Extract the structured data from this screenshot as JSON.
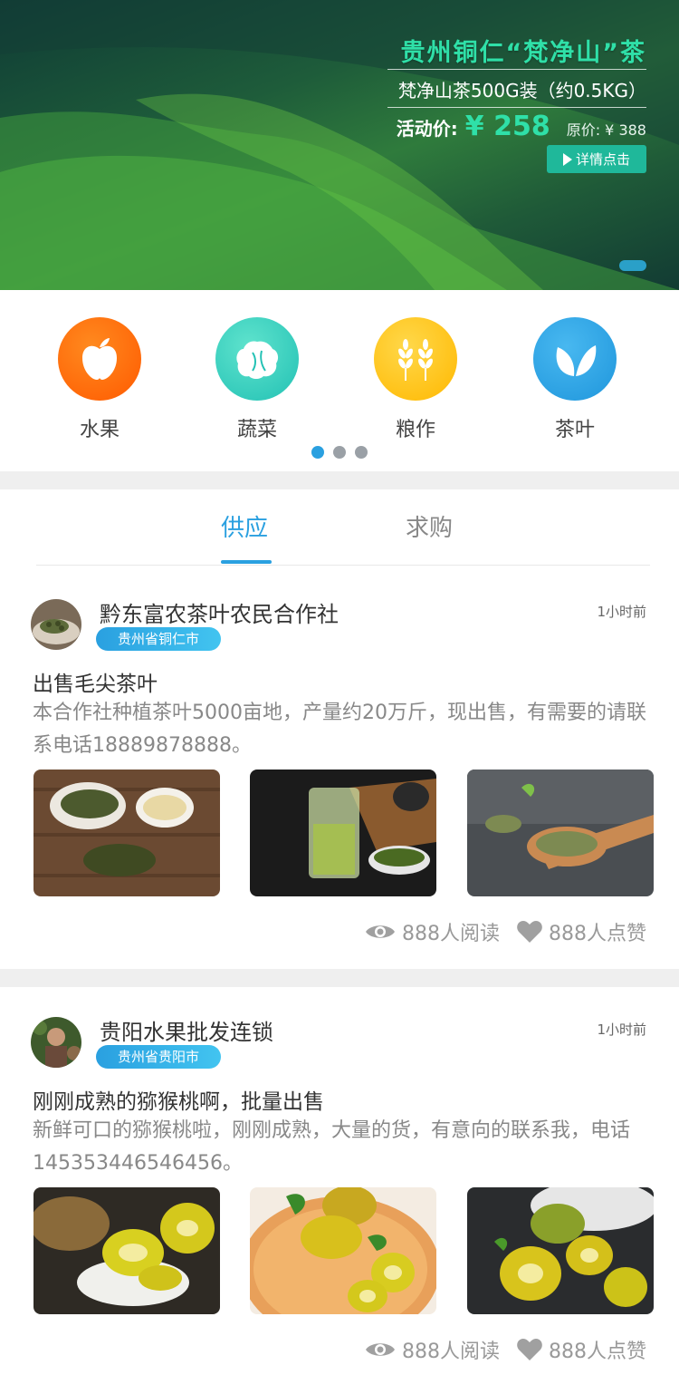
{
  "banner": {
    "title": "贵州铜仁“梵净山”茶",
    "subtitle": "梵净山茶500G装（约0.5KG）",
    "price_label": "活动价:",
    "price_value": "¥ 258",
    "original_price": "原价: ¥ 388",
    "detail_button": "详情点击"
  },
  "categories": [
    {
      "label": "水果",
      "icon": "apple-icon",
      "color": "#ff6d12"
    },
    {
      "label": "蔬菜",
      "icon": "cabbage-icon",
      "color": "#3bd1bf"
    },
    {
      "label": "粮作",
      "icon": "wheat-icon",
      "color": "#ffc21a"
    },
    {
      "label": "茶叶",
      "icon": "tea-leaf-icon",
      "color": "#2aa0e0"
    }
  ],
  "tabs": [
    {
      "label": "供应",
      "active": true
    },
    {
      "label": "求购",
      "active": false
    }
  ],
  "posts": [
    {
      "org": "黔东富农茶叶农民合作社",
      "location": "贵州省铜仁市",
      "time": "1小时前",
      "title": "出售毛尖茶叶",
      "desc": "本合作社种植茶叶5000亩地，产量约20万斤，现出售，有需要的请联系电话18889878888。",
      "reads": "888人阅读",
      "likes": "888人点赞"
    },
    {
      "org": "贵阳水果批发连锁",
      "location": "贵州省贵阳市",
      "time": "1小时前",
      "title": "刚刚成熟的猕猴桃啊，批量出售",
      "desc": "新鲜可口的猕猴桃啦，刚刚成熟，大量的货，有意向的联系我，电话145353446546456。",
      "reads": "888人阅读",
      "likes": "888人点赞"
    }
  ],
  "colors": {
    "accent": "#2aa0e0",
    "banner_green": "#2fe0a8",
    "button_green": "#1fb89a"
  }
}
